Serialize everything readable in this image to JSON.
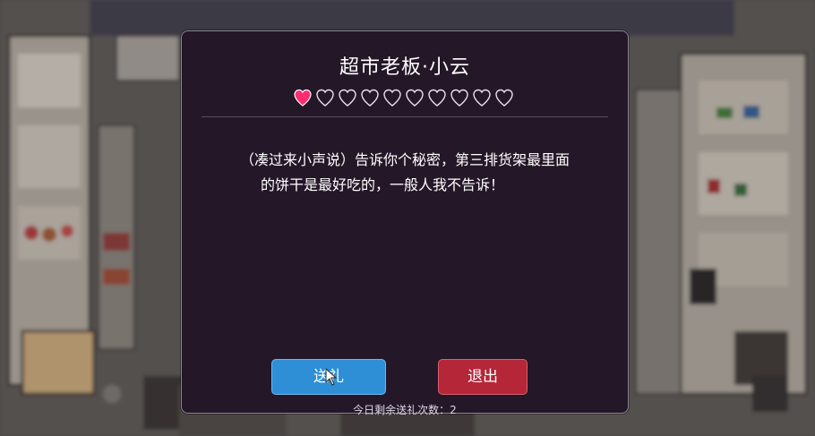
{
  "dialog": {
    "title": "超市老板·小云",
    "affection": {
      "filled": 1,
      "total": 10
    },
    "message_line1": "（凑过来小声说）告诉你个秘密，第三排货架最里面",
    "message_line2": "的饼干是最好吃的，一般人我不告诉！",
    "gift_label": "送礼",
    "exit_label": "退出",
    "remaining_gifts": "今日剩余送礼次数：2"
  },
  "colors": {
    "panel": "#241728",
    "heart_filled": "#ff2d6f",
    "gift_button": "#2e8fd6",
    "exit_button": "#b42638"
  },
  "icons": {
    "heart": "heart-icon",
    "cursor": "pointer-cursor-icon"
  }
}
